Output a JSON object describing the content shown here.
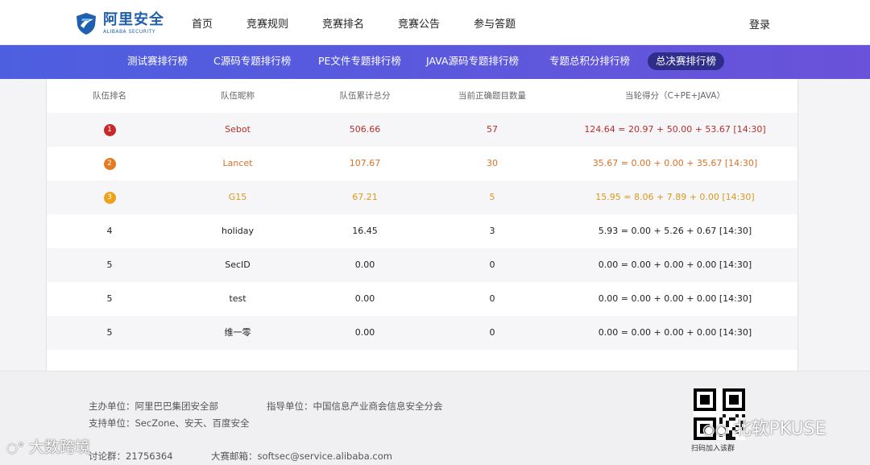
{
  "header": {
    "logo_title": "阿里安全",
    "logo_sub": "ALIBABA SECURITY",
    "nav": [
      "首页",
      "竞赛规则",
      "竞赛排名",
      "竞赛公告",
      "参与答题"
    ],
    "login": "登录"
  },
  "tabs": [
    {
      "label": "测试赛排行榜",
      "active": false
    },
    {
      "label": "C源码专题排行榜",
      "active": false
    },
    {
      "label": "PE文件专题排行榜",
      "active": false
    },
    {
      "label": "JAVA源码专题排行榜",
      "active": false
    },
    {
      "label": "专题总积分排行榜",
      "active": false
    },
    {
      "label": "总决赛排行榜",
      "active": true
    }
  ],
  "table": {
    "columns": [
      "队伍排名",
      "队伍昵称",
      "队伍累计总分",
      "当前正确题目数量",
      "当轮得分（C+PE+JAVA）"
    ],
    "rows": [
      {
        "rank": "1",
        "name": "Sebot",
        "total": "506.66",
        "correct": "57",
        "round": "124.64 = 20.97 + 50.00 + 53.67 [14:30]",
        "color": "#b3302b",
        "badge": "#c8282a"
      },
      {
        "rank": "2",
        "name": "Lancet",
        "total": "107.67",
        "correct": "30",
        "round": "35.67 = 0.00 + 0.00 + 35.67 [14:30]",
        "color": "#d9722a",
        "badge": "#e47a22"
      },
      {
        "rank": "3",
        "name": "G15",
        "total": "67.21",
        "correct": "5",
        "round": "15.95 = 8.06 + 7.89 + 0.00 [14:30]",
        "color": "#d89a1e",
        "badge": "#eea21a"
      },
      {
        "rank": "4",
        "name": "holiday",
        "total": "16.45",
        "correct": "3",
        "round": "5.93 = 0.00 + 5.26 + 0.67 [14:30]",
        "color": "#222222",
        "badge": ""
      },
      {
        "rank": "5",
        "name": "SecID",
        "total": "0.00",
        "correct": "0",
        "round": "0.00 = 0.00 + 0.00 + 0.00 [14:30]",
        "color": "#222222",
        "badge": ""
      },
      {
        "rank": "5",
        "name": "test",
        "total": "0.00",
        "correct": "0",
        "round": "0.00 = 0.00 + 0.00 + 0.00 [14:30]",
        "color": "#222222",
        "badge": ""
      },
      {
        "rank": "5",
        "name": "维一零",
        "total": "0.00",
        "correct": "0",
        "round": "0.00 = 0.00 + 0.00 + 0.00 [14:30]",
        "color": "#222222",
        "badge": ""
      }
    ]
  },
  "footer": {
    "host": "主办单位：阿里巴巴集团安全部",
    "guide": "指导单位：中国信息产业商会信息安全分会",
    "support": "支持单位：SecZone、安天、百度安全",
    "qq_group": "讨论群：21756364",
    "email": "大赛邮箱：softsec@service.alibaba.com",
    "qr_caption": "扫码加入该群"
  },
  "watermarks": {
    "left": "大数跨境",
    "right": "北软PKUSE"
  },
  "colors": {
    "tabbar_start": "#4d5fe0",
    "tabbar_end": "#6a52da",
    "active_tab": "#2e2e8a",
    "logo": "#1f5fb0"
  }
}
